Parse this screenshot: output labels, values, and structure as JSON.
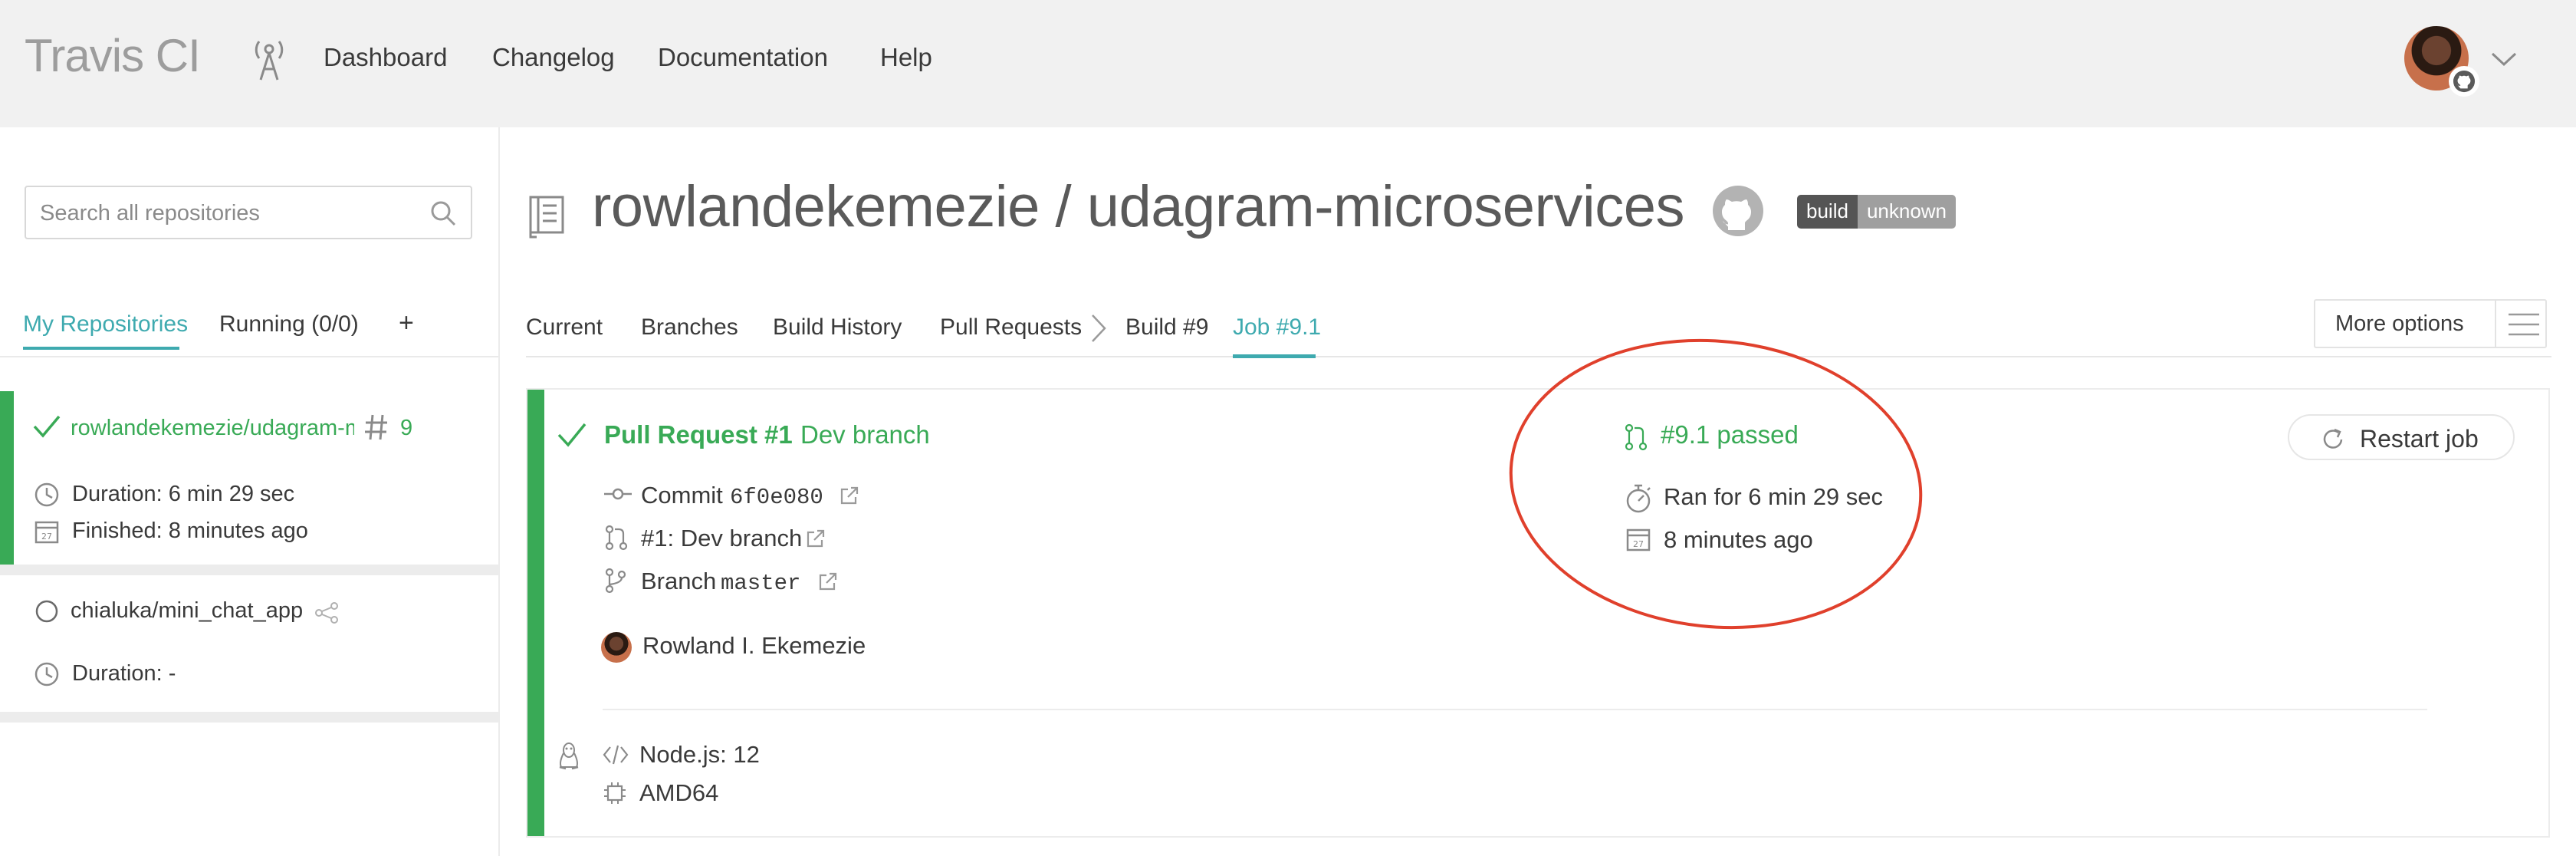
{
  "nav": {
    "brand": "Travis CI",
    "links": [
      "Dashboard",
      "Changelog",
      "Documentation",
      "Help"
    ]
  },
  "sidebar": {
    "search_placeholder": "Search all repositories",
    "tabs": [
      "My Repositories",
      "Running (0/0)",
      "+"
    ],
    "repos": [
      {
        "name": "rowlandekemezie/udagram-microservices",
        "build_number": "9",
        "duration": "Duration: 6 min 29 sec",
        "finished": "Finished: 8 minutes ago",
        "status": "passed"
      },
      {
        "name": "chialuka/mini_chat_app",
        "duration": "Duration: -",
        "status": "none"
      }
    ]
  },
  "main": {
    "repo_title": "rowlandekemezie / udagram-microservices",
    "badge": {
      "left": "build",
      "right": "unknown"
    },
    "tabs": [
      "Current",
      "Branches",
      "Build History",
      "Pull Requests",
      "Build #9",
      "Job #9.1"
    ],
    "more_options": "More options",
    "job": {
      "title": "Pull Request #1",
      "branch_name": "Dev branch",
      "commit_label": "Commit",
      "commit_sha": "6f0e080",
      "pr_link": "#1: Dev branch",
      "branch_label": "Branch",
      "branch_value": "master",
      "author": "Rowland I. Ekemezie",
      "status": "#9.1 passed",
      "ran_for": "Ran for 6 min 29 sec",
      "ago": "8 minutes ago",
      "restart": "Restart job",
      "language": "Node.js: 12",
      "arch": "AMD64"
    }
  },
  "colors": {
    "passed": "#39aa56",
    "accent": "#3eaaaf",
    "annotation": "#e0402c"
  },
  "icons": [
    "antenna-icon",
    "search-icon",
    "check-icon",
    "hash-icon",
    "clock-icon",
    "calendar-icon",
    "repo-book-icon",
    "github-icon",
    "commit-icon",
    "pull-request-icon",
    "branch-icon",
    "external-link-icon",
    "restart-icon",
    "stopwatch-icon",
    "linux-icon",
    "code-icon",
    "cpu-icon",
    "menu-icon",
    "chevron-down-icon"
  ]
}
